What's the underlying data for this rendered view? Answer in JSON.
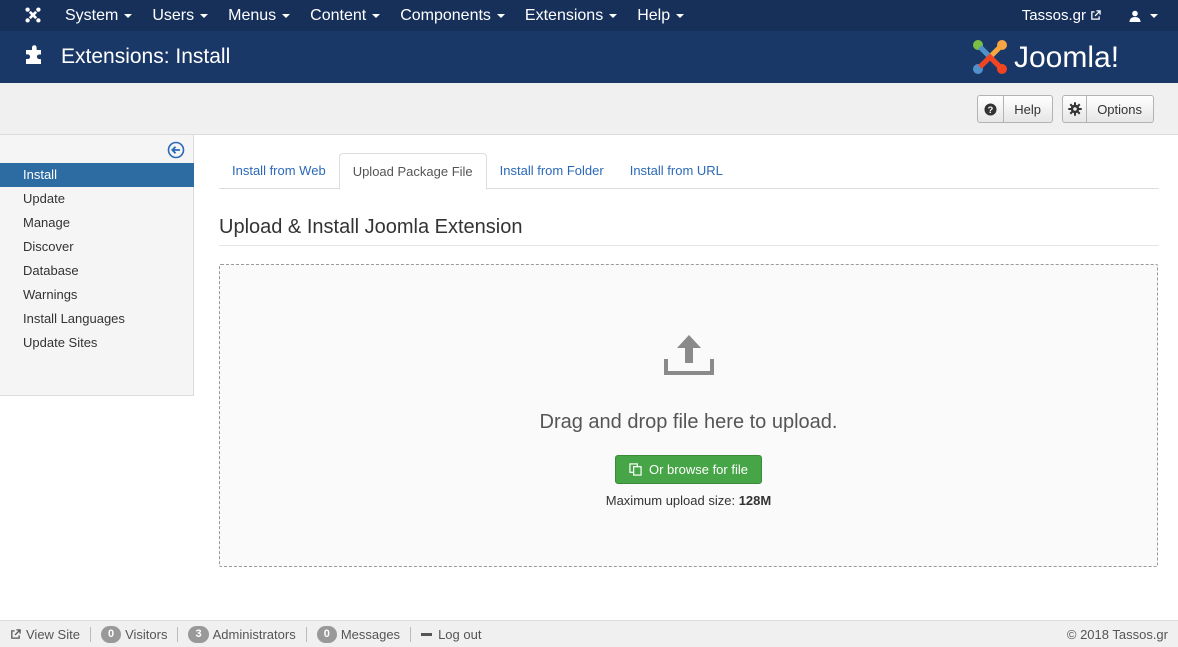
{
  "navbar": {
    "menu": [
      {
        "label": "System",
        "name": "nav-system"
      },
      {
        "label": "Users",
        "name": "nav-users"
      },
      {
        "label": "Menus",
        "name": "nav-menus"
      },
      {
        "label": "Content",
        "name": "nav-content"
      },
      {
        "label": "Components",
        "name": "nav-components"
      },
      {
        "label": "Extensions",
        "name": "nav-extensions"
      },
      {
        "label": "Help",
        "name": "nav-help"
      }
    ],
    "site_name": "Tassos.gr",
    "logo_icon": "joomla-icon",
    "user_icon": "user-icon",
    "background_color": "#17305a"
  },
  "header": {
    "title": "Extensions: Install",
    "icon": "puzzle-piece-icon",
    "brand": "Joomla!",
    "background_color": "#1a3867"
  },
  "toolbar": {
    "help_label": "Help",
    "options_label": "Options"
  },
  "sidebar": {
    "items": [
      {
        "label": "Install",
        "active": true
      },
      {
        "label": "Update",
        "active": false
      },
      {
        "label": "Manage",
        "active": false
      },
      {
        "label": "Discover",
        "active": false
      },
      {
        "label": "Database",
        "active": false
      },
      {
        "label": "Warnings",
        "active": false
      },
      {
        "label": "Install Languages",
        "active": false
      },
      {
        "label": "Update Sites",
        "active": false
      }
    ],
    "active_color": "#2d6ca2"
  },
  "tabs": [
    {
      "label": "Install from Web",
      "active": false
    },
    {
      "label": "Upload Package File",
      "active": true
    },
    {
      "label": "Install from Folder",
      "active": false
    },
    {
      "label": "Install from URL",
      "active": false
    }
  ],
  "main": {
    "heading": "Upload & Install Joomla Extension",
    "drop_text": "Drag and drop file here to upload.",
    "browse_label": "Or browse for file",
    "max_upload_label": "Maximum upload size:",
    "max_upload_value": "128M",
    "browse_color": "#46a546"
  },
  "statusbar": {
    "view_site": "View Site",
    "visitors_count": "0",
    "visitors_label": "Visitors",
    "admins_count": "3",
    "admins_label": "Administrators",
    "messages_count": "0",
    "messages_label": "Messages",
    "logout": "Log out",
    "copyright": "© 2018 Tassos.gr"
  }
}
